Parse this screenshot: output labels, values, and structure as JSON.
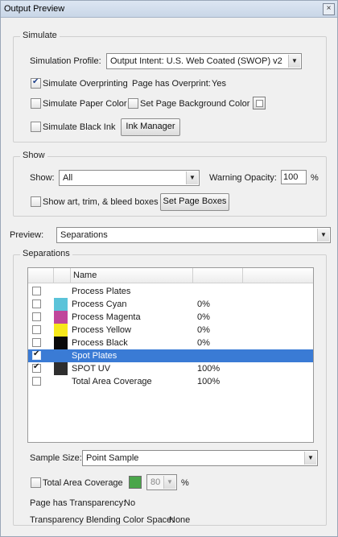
{
  "window": {
    "title": "Output Preview",
    "close_glyph": "×"
  },
  "simulate": {
    "legend": "Simulate",
    "profile_label": "Simulation Profile:",
    "profile_value": "Output Intent: U.S. Web Coated (SWOP) v2",
    "simulate_overprinting": {
      "label": "Simulate Overprinting",
      "checked": true
    },
    "page_has_overprint_label": "Page has Overprint:",
    "page_has_overprint_value": "Yes",
    "simulate_paper_color": {
      "label": "Simulate Paper Color",
      "checked": false
    },
    "set_page_background_color": {
      "label": "Set Page Background Color",
      "checked": false
    },
    "simulate_black_ink": {
      "label": "Simulate Black Ink",
      "checked": false
    },
    "ink_manager_label": "Ink Manager"
  },
  "show": {
    "legend": "Show",
    "show_label": "Show:",
    "show_value": "All",
    "warning_opacity_label": "Warning Opacity:",
    "warning_opacity_value": "100",
    "percent": "%",
    "show_boxes": {
      "label": "Show art, trim, & bleed boxes",
      "checked": false
    },
    "set_page_boxes_label": "Set Page Boxes"
  },
  "preview": {
    "label": "Preview:",
    "value": "Separations"
  },
  "separations": {
    "legend": "Separations",
    "column_name": "Name",
    "rows": [
      {
        "checked": false,
        "swatch": "",
        "name": "Process Plates",
        "value": "",
        "selected": false
      },
      {
        "checked": false,
        "swatch": "#5bc3d9",
        "name": "Process Cyan",
        "value": "0%",
        "selected": false
      },
      {
        "checked": false,
        "swatch": "#c0469b",
        "name": "Process Magenta",
        "value": "0%",
        "selected": false
      },
      {
        "checked": false,
        "swatch": "#f7e81c",
        "name": "Process Yellow",
        "value": "0%",
        "selected": false
      },
      {
        "checked": false,
        "swatch": "#0a0a0a",
        "name": "Process Black",
        "value": "0%",
        "selected": false
      },
      {
        "checked": true,
        "swatch": "",
        "name": "Spot Plates",
        "value": "",
        "selected": true
      },
      {
        "checked": true,
        "swatch": "#2e2e2e",
        "name": "SPOT UV",
        "value": "100%",
        "selected": false
      },
      {
        "checked": false,
        "swatch": "",
        "name": "Total Area Coverage",
        "value": "100%",
        "selected": false
      }
    ],
    "sample_size_label": "Sample Size:",
    "sample_size_value": "Point Sample",
    "total_area_coverage": {
      "label": "Total Area Coverage",
      "checked": false,
      "value": "80",
      "percent": "%"
    },
    "page_has_transparency_label": "Page has Transparency:",
    "page_has_transparency_value": "No",
    "blending_space_label": "Transparency Blending Color Space:",
    "blending_space_value": "None"
  },
  "icons": {
    "dropdown_arrow": "▼",
    "color_swatch_green": "#4aa64a",
    "selection_color": "#3a7bd5"
  }
}
